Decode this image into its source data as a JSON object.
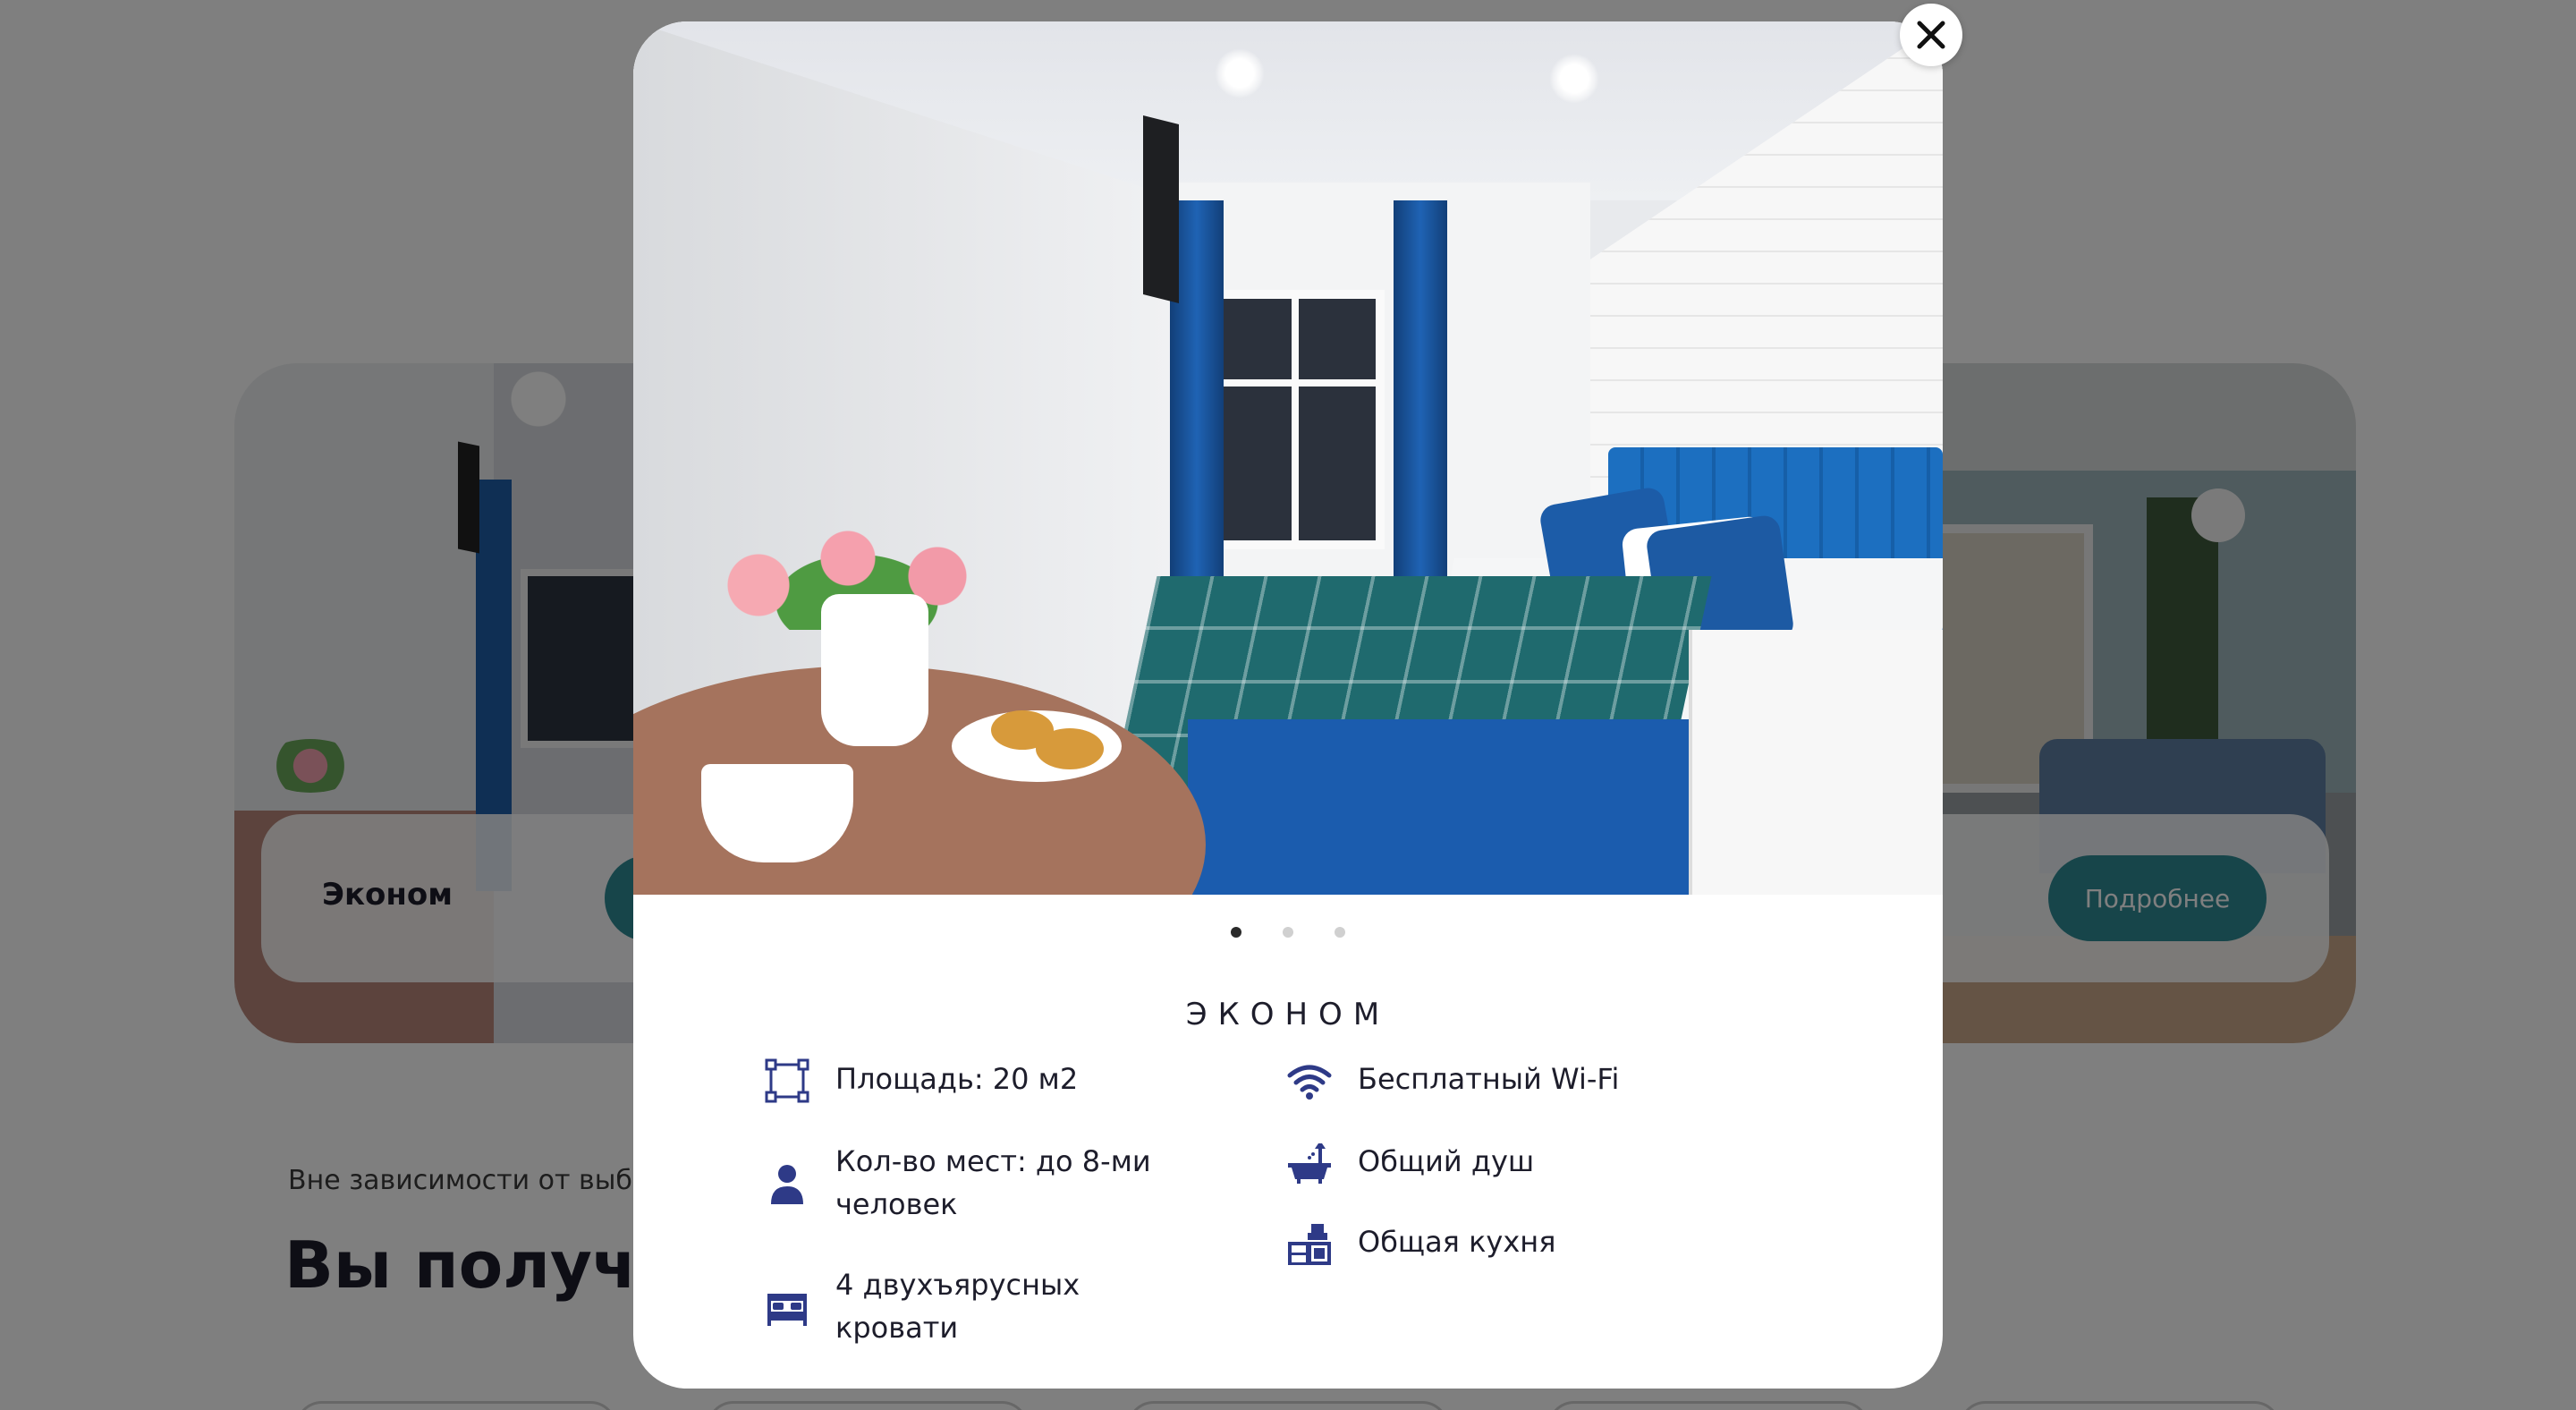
{
  "background": {
    "card_left_title": "Эконом",
    "card_right_button": "Подробнее",
    "section_subtitle": "Вне зависимости от выб",
    "section_title": "Вы получае"
  },
  "modal": {
    "slider": {
      "slides": 3,
      "active": 1
    },
    "room_title": "ЭКОНОМ",
    "features_left": [
      {
        "icon": "area-icon",
        "text": "Площадь: 20 м2"
      },
      {
        "icon": "person-icon",
        "text": "Кол-во мест: до 8-ми человек"
      },
      {
        "icon": "bed-icon",
        "text": "4 двухъярусных кровати"
      }
    ],
    "features_right": [
      {
        "icon": "wifi-icon",
        "text": "Бесплатный Wi-Fi"
      },
      {
        "icon": "bathtub-icon",
        "text": "Общий душ"
      },
      {
        "icon": "kitchen-icon",
        "text": "Общая кухня"
      }
    ],
    "close_icon": "close-icon"
  },
  "colors": {
    "accent": "#2f8a95",
    "icon": "#2e3a87",
    "overlay": "rgba(0,0,0,0.5)"
  }
}
